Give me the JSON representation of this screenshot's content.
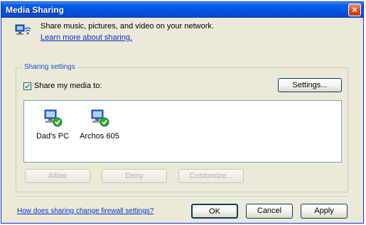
{
  "window": {
    "title": "Media Sharing",
    "close_label": "×"
  },
  "intro": {
    "text": "Share music, pictures, and video on your network.",
    "link": "Learn more about sharing."
  },
  "sharing": {
    "legend": "Sharing settings",
    "checkbox_label": "Share my media to:",
    "checked": true,
    "settings_button": "Settings...",
    "devices": [
      {
        "label": "Dad's PC",
        "icon": "computer-shared-icon"
      },
      {
        "label": "Archos 605",
        "icon": "computer-shared-icon"
      }
    ],
    "allow_button": "Allow",
    "deny_button": "Deny",
    "customize_button": "Customize..."
  },
  "footer": {
    "firewall_link": "How does sharing change firewall settings?",
    "ok_button": "OK",
    "cancel_button": "Cancel",
    "apply_button": "Apply"
  },
  "colors": {
    "titlebar": "#0054e3",
    "dialog_bg": "#ece9d8",
    "link": "#0033cc",
    "legend": "#1c54c8",
    "check_badge": "#2eaa3c"
  }
}
